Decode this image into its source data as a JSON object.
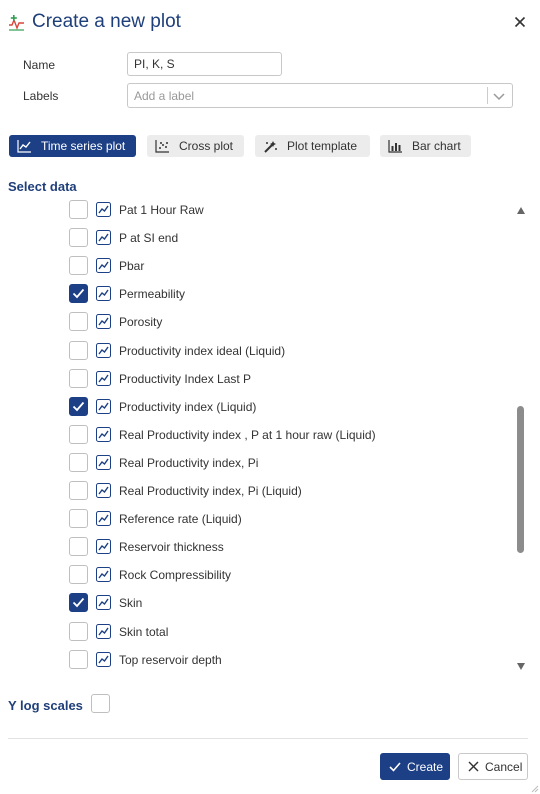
{
  "header": {
    "title": "Create a new plot",
    "icon": "add-plot-icon",
    "close_icon": "close-icon"
  },
  "form": {
    "name_label": "Name",
    "name_value": "PI, K, S",
    "labels_label": "Labels",
    "labels_placeholder": "Add a label"
  },
  "tabs": [
    {
      "label": "Time series plot",
      "icon": "line-chart-icon",
      "active": true
    },
    {
      "label": "Cross plot",
      "icon": "scatter-chart-icon",
      "active": false
    },
    {
      "label": "Plot template",
      "icon": "magic-wand-icon",
      "active": false
    },
    {
      "label": "Bar chart",
      "icon": "bar-chart-icon",
      "active": false
    }
  ],
  "select_data": {
    "title": "Select data",
    "items": [
      {
        "label": "Pat 1 Hour Raw",
        "checked": false
      },
      {
        "label": "P at SI end",
        "checked": false
      },
      {
        "label": "Pbar",
        "checked": false
      },
      {
        "label": "Permeability",
        "checked": true
      },
      {
        "label": "Porosity",
        "checked": false
      },
      {
        "label": "Productivity index ideal (Liquid)",
        "checked": false
      },
      {
        "label": "Productivity Index Last P",
        "checked": false
      },
      {
        "label": "Productivity index (Liquid)",
        "checked": true
      },
      {
        "label": "Real Productivity index , P at 1 hour raw (Liquid)",
        "checked": false
      },
      {
        "label": "Real Productivity index, Pi",
        "checked": false
      },
      {
        "label": "Real Productivity index, Pi (Liquid)",
        "checked": false
      },
      {
        "label": "Reference rate (Liquid)",
        "checked": false
      },
      {
        "label": "Reservoir thickness",
        "checked": false
      },
      {
        "label": "Rock Compressibility",
        "checked": false
      },
      {
        "label": "Skin",
        "checked": true
      },
      {
        "label": "Skin total",
        "checked": false
      },
      {
        "label": "Top reservoir depth",
        "checked": false
      }
    ]
  },
  "options": {
    "y_log_label": "Y log scales",
    "y_log_checked": false
  },
  "footer": {
    "create_label": "Create",
    "cancel_label": "Cancel"
  },
  "colors": {
    "primary": "#1c3f86",
    "title": "#1f3f7a",
    "icon_green": "#2e9e4f",
    "icon_red": "#d9453b"
  }
}
